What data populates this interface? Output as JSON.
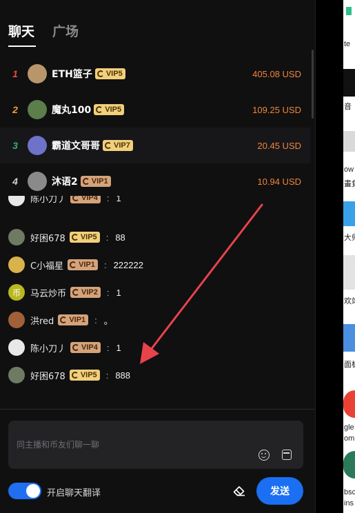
{
  "tabs": [
    {
      "label": "聊天",
      "active": true
    },
    {
      "label": "广场",
      "active": false
    }
  ],
  "leaderboard": [
    {
      "rank": "1",
      "rank_color": "#e84a3a",
      "name": "ETH篮子",
      "vip": "VIP5",
      "vip_style": "gold",
      "amount": "405.08 USD",
      "avatar_color": "#b8966a"
    },
    {
      "rank": "2",
      "rank_color": "#f39a3c",
      "name": "魔丸100",
      "vip": "VIP5",
      "vip_style": "gold",
      "amount": "109.25 USD",
      "avatar_color": "#5b7e4a"
    },
    {
      "rank": "3",
      "rank_color": "#2fb36b",
      "name": "霸道文哥哥",
      "vip": "VIP7",
      "vip_style": "gold",
      "amount": "20.45 USD",
      "avatar_color": "#6f72c9"
    },
    {
      "rank": "4",
      "rank_color": "#cfcfcf",
      "name": "沐语2",
      "vip": "VIP1",
      "vip_style": "tan",
      "amount": "10.94 USD",
      "avatar_color": "#8a8a8a"
    }
  ],
  "chat": [
    {
      "name": "陈小刀丿",
      "vip": "VIP4",
      "vip_style": "tan",
      "sep": ":",
      "msg": "1",
      "avatar_color": "#e8e8e8"
    },
    {
      "name": "好困678",
      "vip": "VIP5",
      "vip_style": "gold",
      "sep": ":",
      "msg": "88",
      "avatar_color": "#6f7a63"
    },
    {
      "name": "C小福星",
      "vip": "VIP1",
      "vip_style": "tan",
      "sep": ":",
      "msg": "222222",
      "avatar_color": "#d8b24a"
    },
    {
      "name": "马云炒币",
      "vip": "VIP2",
      "vip_style": "tan",
      "sep": ":",
      "msg": "1",
      "avatar_color": "#b9b81f",
      "avatar_glyph": "币"
    },
    {
      "name": "洪red",
      "vip": "VIP1",
      "vip_style": "tan",
      "sep": ":",
      "msg": "。",
      "avatar_color": "#a0603a"
    },
    {
      "name": "陈小刀丿",
      "vip": "VIP4",
      "vip_style": "tan",
      "sep": ":",
      "msg": "1",
      "avatar_color": "#e8e8e8"
    },
    {
      "name": "好困678",
      "vip": "VIP5",
      "vip_style": "gold",
      "sep": ":",
      "msg": "888",
      "avatar_color": "#6f7a63"
    }
  ],
  "input": {
    "placeholder": "同主播和币友们聊一聊",
    "value": ""
  },
  "translate_toggle": {
    "label": "开启聊天翻译",
    "on": true
  },
  "send_label": "发送",
  "right_strip_texts": [
    "te",
    "音",
    "ow",
    "畫負",
    "大师",
    "欢站",
    "面板",
    "gle",
    "om",
    "bsc",
    "ins"
  ],
  "colors": {
    "accent": "#1a6ff2",
    "amount": "#f0853a",
    "panel_bg": "#101011",
    "annotation_arrow": "#e8434b"
  }
}
